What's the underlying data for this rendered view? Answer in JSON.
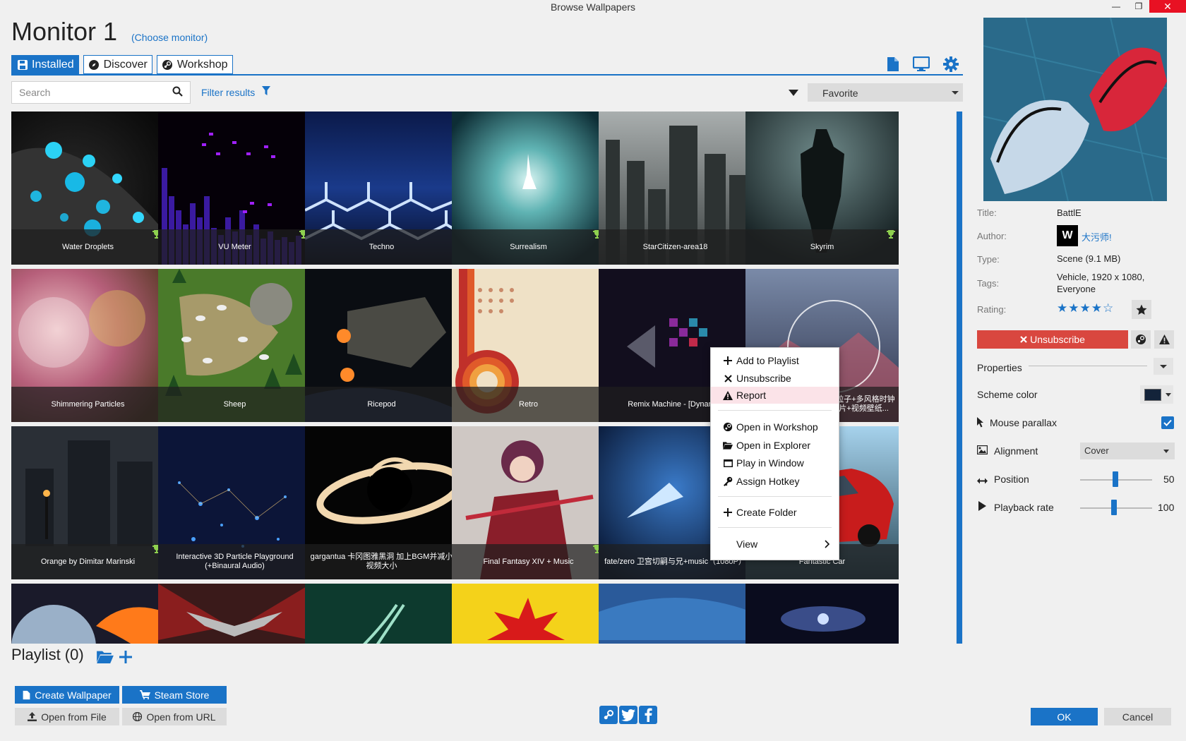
{
  "window": {
    "title": "Browse Wallpapers",
    "minimize": "—",
    "restore": "❐",
    "close": "✕"
  },
  "header": {
    "monitor_title": "Monitor 1",
    "choose_monitor": "(Choose monitor)",
    "tabs": [
      {
        "label": "Installed",
        "icon": "save-icon",
        "active": true
      },
      {
        "label": "Discover",
        "icon": "compass-icon",
        "active": false
      },
      {
        "label": "Workshop",
        "icon": "steam-icon",
        "active": false
      }
    ],
    "right_icons": [
      "document-icon",
      "monitor-icon",
      "gear-icon"
    ]
  },
  "toolbar": {
    "search_placeholder": "Search",
    "filter_label": "Filter results",
    "sort_value": "Favorite"
  },
  "wallpapers": [
    {
      "title": "Water Droplets",
      "trophy": true
    },
    {
      "title": "VU Meter",
      "trophy": true
    },
    {
      "title": "Techno",
      "trophy": false
    },
    {
      "title": "Surrealism",
      "trophy": true
    },
    {
      "title": "StarCitizen-area18",
      "trophy": false
    },
    {
      "title": "Skyrim",
      "trophy": true
    },
    {
      "title": "Shimmering Particles",
      "trophy": false
    },
    {
      "title": "Sheep",
      "trophy": false
    },
    {
      "title": "Ricepod",
      "trophy": false
    },
    {
      "title": "Retro",
      "trophy": false
    },
    {
      "title": "Remix Machine - [Dynamic]",
      "trophy": false
    },
    {
      "title": "...llpaper-完美壁纸【落樱粒子+多风格时钟+音频响应+自定义+幻灯片+视频壁纸...",
      "trophy": false
    },
    {
      "title": "Orange by Dimitar Marinski",
      "trophy": true
    },
    {
      "title": "Interactive 3D Particle Playground (+Binaural Audio)",
      "trophy": false
    },
    {
      "title": "gargantua 卡冈图雅黑洞 加上BGM并减小视频大小",
      "trophy": false
    },
    {
      "title": "Final Fantasy XIV + Music",
      "trophy": true
    },
    {
      "title": "fate/zero 卫宫切嗣与兄+music（1080P）",
      "trophy": false
    },
    {
      "title": "Fantastic Car",
      "trophy": false
    },
    {
      "title": "",
      "trophy": false
    },
    {
      "title": "",
      "trophy": false
    },
    {
      "title": "",
      "trophy": false
    },
    {
      "title": "",
      "trophy": false
    },
    {
      "title": "",
      "trophy": false
    },
    {
      "title": "",
      "trophy": false
    }
  ],
  "context_menu": {
    "items": [
      {
        "label": "Add to Playlist",
        "icon": "plus-icon"
      },
      {
        "label": "Unsubscribe",
        "icon": "x-icon"
      },
      {
        "label": "Report",
        "icon": "warning-icon",
        "highlighted": true
      },
      {
        "label": "Open in Workshop",
        "icon": "steam-icon"
      },
      {
        "label": "Open in Explorer",
        "icon": "folder-open-icon"
      },
      {
        "label": "Play in Window",
        "icon": "window-icon"
      },
      {
        "label": "Assign Hotkey",
        "icon": "key-icon"
      },
      {
        "label": "Create Folder",
        "icon": "plus-icon"
      },
      {
        "label": "View",
        "icon": "chevron-right-icon"
      }
    ]
  },
  "details": {
    "title_label": "Title:",
    "title_value": "BattlE",
    "author_label": "Author:",
    "author_value": "大污师!",
    "author_avatar_text": "W",
    "type_label": "Type:",
    "type_value": "Scene (9.1 MB)",
    "tags_label": "Tags:",
    "tags_value": "Vehicle, 1920 x 1080, Everyone",
    "rating_label": "Rating:",
    "rating_stars": "★★★★☆",
    "rating_value": 4,
    "unsubscribe_label": "Unsubscribe"
  },
  "properties": {
    "header": "Properties",
    "scheme_color_label": "Scheme color",
    "scheme_color": "#13233a",
    "mouse_parallax_label": "Mouse parallax",
    "mouse_parallax": true,
    "alignment_label": "Alignment",
    "alignment_value": "Cover",
    "position_label": "Position",
    "position_value": "50",
    "playback_label": "Playback rate",
    "playback_value": "100"
  },
  "playlist": {
    "title": "Playlist (0)"
  },
  "bottom": {
    "create_wallpaper": "Create Wallpaper",
    "steam_store": "Steam Store",
    "open_from_file": "Open from File",
    "open_from_url": "Open from URL",
    "ok": "OK",
    "cancel": "Cancel"
  },
  "colors": {
    "accent": "#1a73c7",
    "danger": "#d9473f"
  }
}
